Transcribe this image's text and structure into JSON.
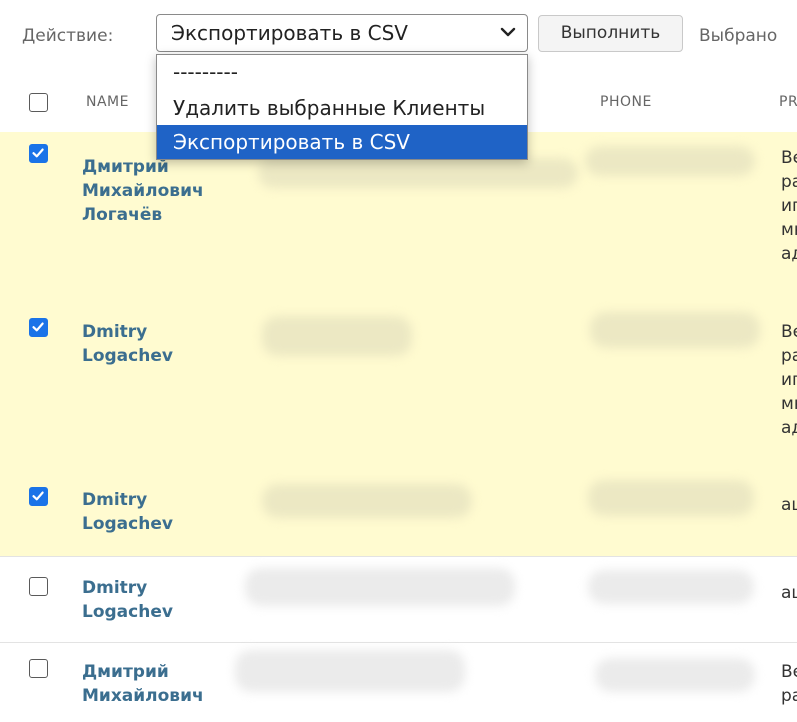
{
  "action_bar": {
    "label": "Действие:",
    "selected_value": "Экспортировать в CSV",
    "run_label": "Выполнить",
    "selected_counter": "Выбрано"
  },
  "dropdown": {
    "options": [
      "---------",
      "Удалить выбранные Клиенты",
      "Экспортировать в CSV"
    ],
    "highlighted_index": 2
  },
  "table": {
    "columns": [
      "NAME",
      "PHONE",
      "PR"
    ],
    "rows": [
      {
        "checked": true,
        "name_lines": [
          "Дмитрий",
          "Михайлович",
          "Логачёв"
        ],
        "profile_lines": [
          "Ве",
          "ра",
          "иг",
          "мн",
          "ад"
        ]
      },
      {
        "checked": true,
        "name_lines": [
          "Dmitry",
          "Logachev"
        ],
        "profile_lines": [
          "Ве",
          "ра",
          "иг",
          "мн",
          "ад"
        ]
      },
      {
        "checked": true,
        "name_lines": [
          "Dmitry",
          "Logachev"
        ],
        "profile_lines": [
          "ац"
        ]
      },
      {
        "checked": false,
        "name_lines": [
          "Dmitry",
          "Logachev"
        ],
        "profile_lines": [
          "ац"
        ]
      },
      {
        "checked": false,
        "name_lines": [
          "Дмитрий",
          "Михайлович"
        ],
        "profile_lines": [
          "Ве",
          "ра"
        ]
      }
    ]
  },
  "colors": {
    "selected_row_bg": "#fffbd0",
    "link_name": "#3b6e8f",
    "highlight_option": "#1f63c6",
    "checkbox_checked": "#1a73e8"
  }
}
